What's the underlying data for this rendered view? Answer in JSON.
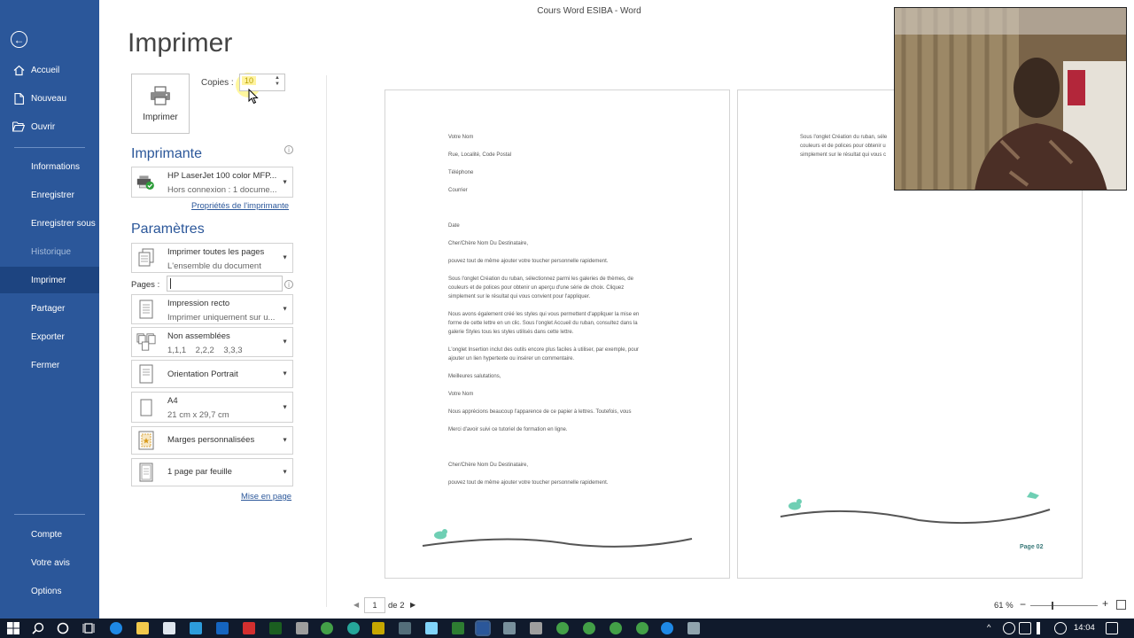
{
  "window": {
    "title": "Cours Word ESIBA  -  Word"
  },
  "sidebar": {
    "back_icon": "arrow-left-circle-icon",
    "items": [
      {
        "label": "Accueil",
        "icon": "home-icon"
      },
      {
        "label": "Nouveau",
        "icon": "new-doc-icon"
      },
      {
        "label": "Ouvrir",
        "icon": "folder-open-icon"
      },
      {
        "label": "Informations"
      },
      {
        "label": "Enregistrer"
      },
      {
        "label": "Enregistrer sous"
      },
      {
        "label": "Historique",
        "state": "disabled"
      },
      {
        "label": "Imprimer",
        "state": "active"
      },
      {
        "label": "Partager"
      },
      {
        "label": "Exporter"
      },
      {
        "label": "Fermer"
      },
      {
        "label": "Compte"
      },
      {
        "label": "Votre avis"
      },
      {
        "label": "Options"
      }
    ],
    "accent": "#2b579a",
    "active_bg": "#1d4480"
  },
  "main": {
    "title": "Imprimer",
    "print_button_label": "Imprimer",
    "copies_label": "Copies :",
    "copies_value": "10",
    "printer_section": "Imprimante",
    "printer_name": "HP LaserJet 100 color MFP...",
    "printer_status": "Hors connexion : 1 docume...",
    "printer_properties_link": "Propriétés de l'imprimante",
    "settings_section": "Paramètres",
    "settings": [
      {
        "line1": "Imprimer toutes les pages",
        "line2": "L'ensemble du document",
        "icon": "pages-icon"
      },
      {
        "line1": "Impression recto",
        "line2": "Imprimer uniquement sur u...",
        "icon": "single-sided-icon"
      },
      {
        "line1": "Non assemblées",
        "line2": "1,1,1    2,2,2    3,3,3",
        "icon": "uncollated-icon"
      },
      {
        "line1": "Orientation Portrait",
        "line2": "",
        "icon": "portrait-icon"
      },
      {
        "line1": "A4",
        "line2": "21 cm x 29,7 cm",
        "icon": "paper-size-icon"
      },
      {
        "line1": "Marges personnalisées",
        "line2": "",
        "icon": "margins-icon"
      },
      {
        "line1": "1 page par feuille",
        "line2": "",
        "icon": "pages-per-sheet-icon"
      }
    ],
    "pages_label": "Pages :",
    "pages_value": "",
    "page_setup_link": "Mise en page"
  },
  "preview": {
    "page1_lines": [
      "Votre Nom",
      "Rue, Localité, Code Postal",
      "Téléphone",
      "Courrier",
      "Date",
      "Cher/Chère Nom Du Destinataire,",
      "pouvez tout de même ajouter votre toucher personnelle rapidement.",
      "Sous l'onglet Création du ruban, sélectionnez parmi les galeries de thèmes, de",
      "couleurs et de polices pour obtenir un aperçu d'une série de choix. Cliquez",
      "simplement sur le résultat qui vous convient pour l'appliquer.",
      "Nous avons également créé les styles qui vous permettent d'appliquer la mise en",
      "forme de cette lettre en un clic. Sous l'onglet Accueil du ruban, consultez dans la",
      "galerie Styles tous les styles utilisés dans cette lettre.",
      "L'onglet Insertion inclut des outils encore plus faciles à utiliser, par exemple, pour",
      "ajouter un lien hypertexte ou insérer un commentaire.",
      "Meilleures salutations,",
      "Votre Nom",
      "Nous apprécions beaucoup l'apparence de ce papier à lettres. Toutefois, vous",
      "Merci d'avoir suivi ce tutoriel de formation en ligne.",
      "Cher/Chère Nom Du Destinataire,",
      "pouvez tout de même ajouter votre toucher personnelle rapidement."
    ],
    "page2_lines": [
      "Sous l'onglet Création du ruban, séle",
      "couleurs et de polices pour obtenir u",
      "simplement sur le résultat qui vous c"
    ],
    "page2_footer": "Page 02",
    "bird_color": "#6fcfb4"
  },
  "footer": {
    "current_page": "1",
    "of_pages": "de 2",
    "zoom": "61 %"
  },
  "taskbar": {
    "time": "14:04"
  }
}
